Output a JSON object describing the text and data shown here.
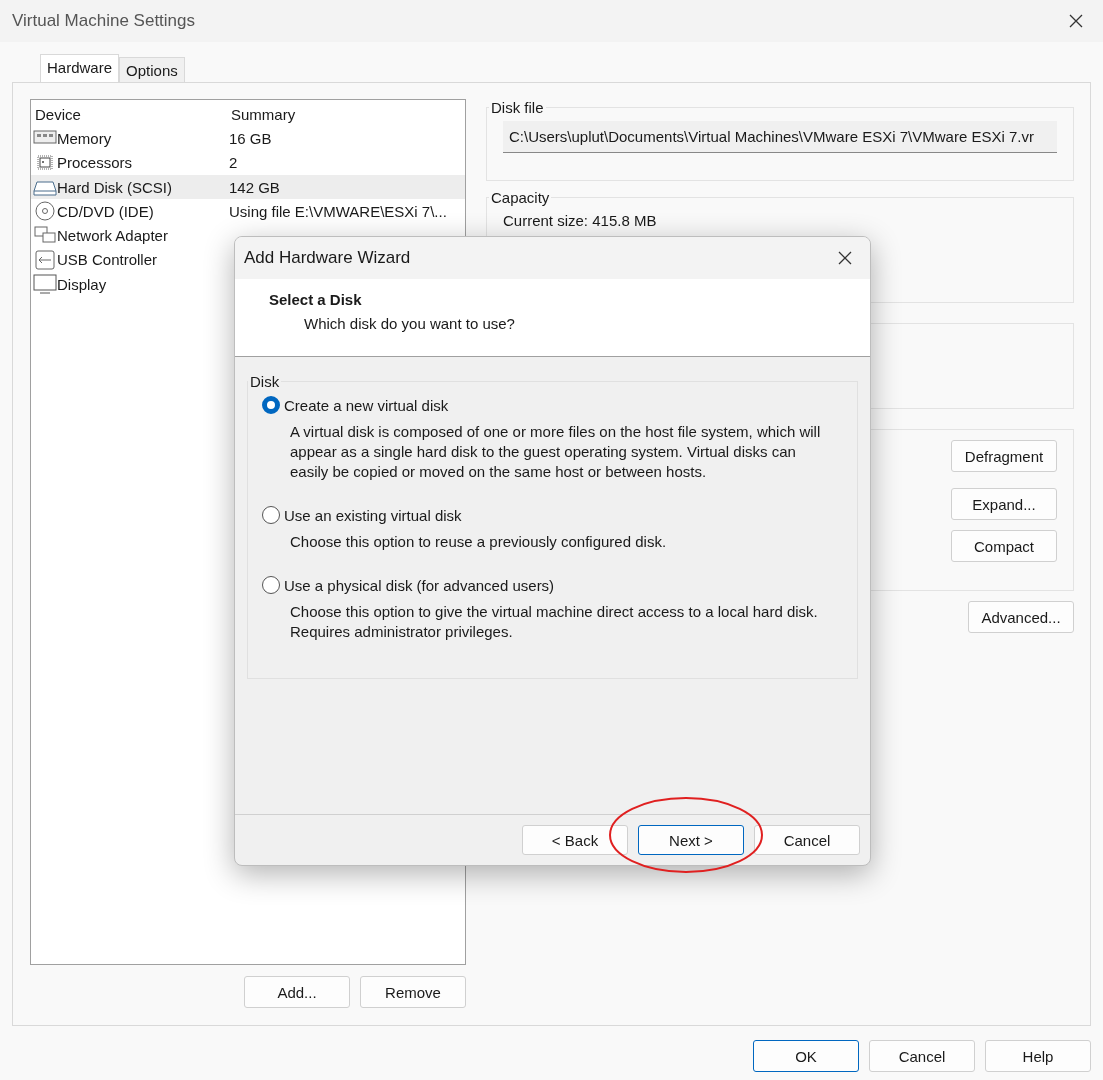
{
  "window": {
    "title": "Virtual Machine Settings"
  },
  "tabs": [
    {
      "label": "Hardware",
      "selected": true
    },
    {
      "label": "Options",
      "selected": false
    }
  ],
  "devices": {
    "columns": [
      "Device",
      "Summary"
    ],
    "rows": [
      {
        "kind": "memory",
        "name": "Memory",
        "summary": "16 GB",
        "selected": false
      },
      {
        "kind": "cpu",
        "name": "Processors",
        "summary": "2",
        "selected": false
      },
      {
        "kind": "disk",
        "name": "Hard Disk (SCSI)",
        "summary": "142 GB",
        "selected": true
      },
      {
        "kind": "cd",
        "name": "CD/DVD (IDE)",
        "summary": "Using file E:\\VMWARE\\ESXi 7\\...",
        "selected": false
      },
      {
        "kind": "network",
        "name": "Network Adapter",
        "selected": false
      },
      {
        "kind": "usb",
        "name": "USB Controller",
        "selected": false
      },
      {
        "kind": "display",
        "name": "Display",
        "selected": false
      }
    ]
  },
  "device_buttons": [
    "Add...",
    "Remove"
  ],
  "disk_file": {
    "label": "Disk file",
    "value": "C:\\Users\\uplut\\Documents\\Virtual Machines\\VMware ESXi 7\\VMware ESXi 7.vr"
  },
  "capacity": {
    "label": "Capacity",
    "current_size": "Current size: 415.8 MB"
  },
  "utility_buttons": [
    "Defragment",
    "Expand...",
    "Compact"
  ],
  "advanced_button": "Advanced...",
  "footer_buttons": [
    {
      "label": "OK",
      "default": true
    },
    {
      "label": "Cancel",
      "default": false
    },
    {
      "label": "Help",
      "default": false
    }
  ],
  "wizard": {
    "title": "Add Hardware Wizard",
    "heading": "Select a Disk",
    "subheading": "Which disk do you want to use?",
    "group": "Disk",
    "options": [
      {
        "label": "Create a new virtual disk",
        "description": "A virtual disk is composed of one or more files on the host file system, which will appear as a single hard disk to the guest operating system. Virtual disks can easily be copied or moved on the same host or between hosts.",
        "selected": true
      },
      {
        "label": "Use an existing virtual disk",
        "description": "Choose this option to reuse a previously configured disk.",
        "selected": false
      },
      {
        "label": "Use a physical disk (for advanced users)",
        "description": "Choose this option to give the virtual machine direct access to a local hard disk. Requires administrator privileges.",
        "selected": false
      }
    ],
    "buttons": [
      {
        "label": "< Back",
        "default": false
      },
      {
        "label": "Next >",
        "default": true
      },
      {
        "label": "Cancel",
        "default": false
      }
    ]
  }
}
